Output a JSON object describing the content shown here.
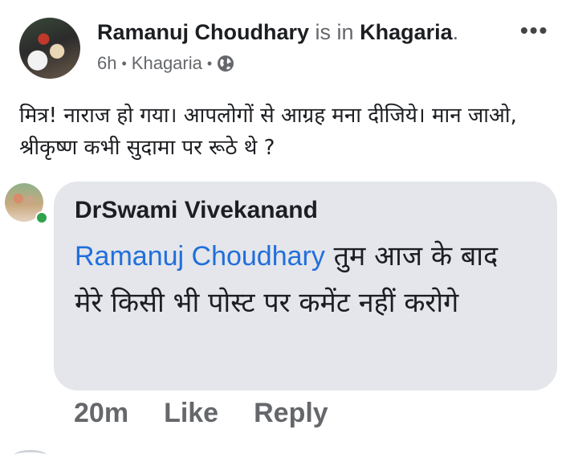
{
  "post": {
    "author": "Ramanuj Choudhary",
    "is_in": "is in",
    "place": "Khagaria",
    "place_suffix": ".",
    "time": "6h",
    "location": "Khagaria",
    "separator": "•",
    "more_icon": "more-options-icon",
    "privacy_icon": "globe-icon",
    "text": "मित्र! नाराज हो गया। आपलोगों से आग्रह मना दीजिये। मान जाओ, श्रीकृष्ण कभी सुदामा पर रूठे थे ?"
  },
  "comment": {
    "author": "DrSwami Vivekanand",
    "mention": "Ramanuj Choudhary",
    "text": " तुम आज के बाद मेरे किसी भी पोस्ट पर कमेंट नहीं करोगे",
    "time": "20m",
    "like_label": "Like",
    "reply_label": "Reply"
  },
  "colors": {
    "mention": "#216fdb",
    "bubble": "#e4e6eb",
    "online": "#31a24c",
    "muted": "#65676b"
  }
}
